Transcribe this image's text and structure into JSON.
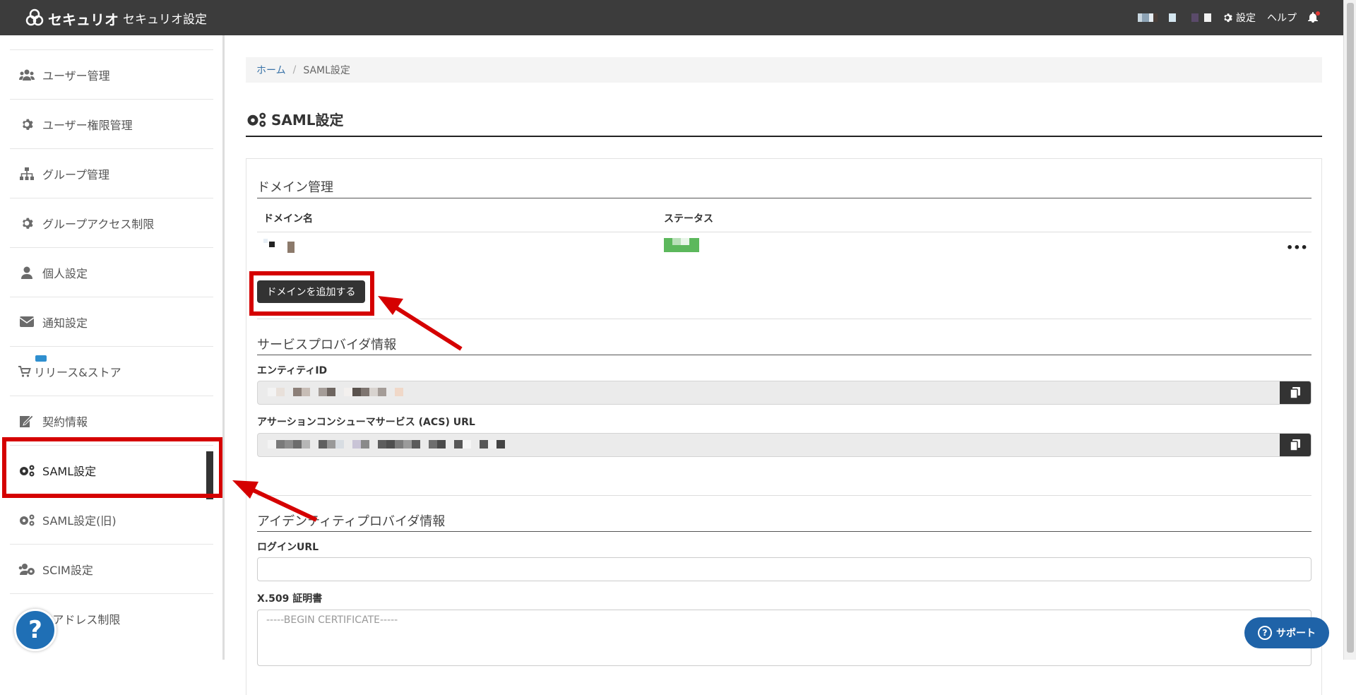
{
  "header": {
    "logo_text": "セキュリオ",
    "title": "セキュリオ設定",
    "settings_label": "設定",
    "help_label": "ヘルプ"
  },
  "sidebar": {
    "items": [
      {
        "label": "ユーザー管理",
        "icon": "users-icon"
      },
      {
        "label": "ユーザー権限管理",
        "icon": "gear-icon"
      },
      {
        "label": "グループ管理",
        "icon": "sitemap-icon"
      },
      {
        "label": "グループアクセス制限",
        "icon": "gear-icon"
      },
      {
        "label": "個人設定",
        "icon": "user-icon"
      },
      {
        "label": "通知設定",
        "icon": "envelope-icon"
      },
      {
        "label": "リリース&ストア",
        "icon": "cart-icon"
      },
      {
        "label": "契約情報",
        "icon": "contract-edit-icon"
      },
      {
        "label": "SAML設定",
        "icon": "gears-icon",
        "active": true
      },
      {
        "label": "SAML設定(旧)",
        "icon": "gears-icon"
      },
      {
        "label": "SCIM設定",
        "icon": "users-cog-icon"
      },
      {
        "label": "IPアドレス制限",
        "icon": "map-marker-icon"
      }
    ]
  },
  "breadcrumb": {
    "home": "ホーム",
    "separator": "/",
    "current": "SAML設定"
  },
  "page": {
    "title": "SAML設定"
  },
  "domain_section": {
    "title": "ドメイン管理",
    "col_domain": "ドメイン名",
    "col_status": "ステータス",
    "more_label": "•••",
    "add_button": "ドメインを追加する"
  },
  "sp_section": {
    "title": "サービスプロバイダ情報",
    "entity_id_label": "エンティティID",
    "acs_url_label": "アサーションコンシューマサービス (ACS) URL"
  },
  "idp_section": {
    "title": "アイデンティティプロバイダ情報",
    "login_url_label": "ログインURL",
    "login_url_value": "",
    "cert_label": "X.509 証明書",
    "cert_placeholder": "-----BEGIN CERTIFICATE-----"
  },
  "support_button": "サポート",
  "colors": {
    "header_bg": "#3c3c3c",
    "accent_dark": "#333333",
    "highlight_red": "#d50000",
    "link_blue": "#3a73a8",
    "status_green": "#5cb85c",
    "fab_blue": "#1f6fb5"
  }
}
